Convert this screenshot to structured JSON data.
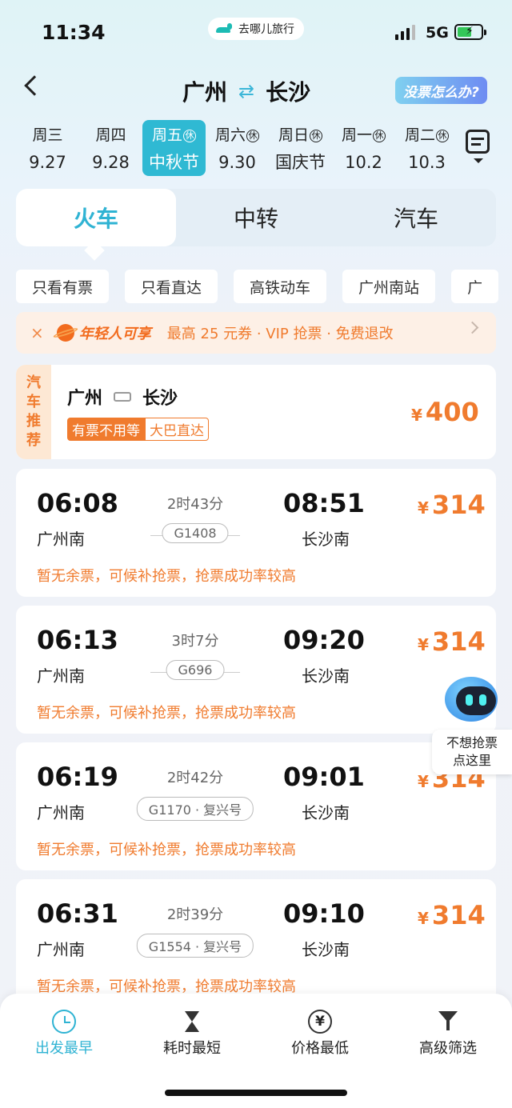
{
  "status_bar": {
    "time": "11:34",
    "app_badge": "去哪儿旅行",
    "network": "5G"
  },
  "header": {
    "from": "广州",
    "to": "长沙",
    "help_button": "没票怎么办?"
  },
  "dates": [
    {
      "weekday": "周三",
      "date": "9.27",
      "rest": false,
      "active": false
    },
    {
      "weekday": "周四",
      "date": "9.28",
      "rest": false,
      "active": false
    },
    {
      "weekday": "周五",
      "date": "中秋节",
      "rest": true,
      "active": true
    },
    {
      "weekday": "周六",
      "date": "9.30",
      "rest": true,
      "active": false
    },
    {
      "weekday": "周日",
      "date": "国庆节",
      "rest": true,
      "active": false
    },
    {
      "weekday": "周一",
      "date": "10.2",
      "rest": true,
      "active": false
    },
    {
      "weekday": "周二",
      "date": "10.3",
      "rest": true,
      "active": false
    }
  ],
  "rest_mark": "休",
  "mode_tabs": {
    "train": "火车",
    "transfer": "中转",
    "bus": "汽车"
  },
  "filters": [
    "只看有票",
    "只看直达",
    "高铁动车",
    "广州南站",
    "广"
  ],
  "promo": {
    "close": "×",
    "tag": "年轻人可享",
    "text": "最高 25 元券 · VIP 抢票 · 免费退改"
  },
  "bus_card": {
    "side_label": "汽车推荐",
    "from": "广州",
    "to": "长沙",
    "tag1": "有票不用等",
    "tag2": "大巴直达",
    "currency": "¥",
    "price": "400"
  },
  "trains": [
    {
      "dep": "06:08",
      "arr": "08:51",
      "duration": "2时43分",
      "from": "广州南",
      "to": "长沙南",
      "number": "G1408",
      "price": "314",
      "note": "暂无余票，可候补抢票，抢票成功率较高"
    },
    {
      "dep": "06:13",
      "arr": "09:20",
      "duration": "3时7分",
      "from": "广州南",
      "to": "长沙南",
      "number": "G696",
      "price": "314",
      "note": "暂无余票，可候补抢票，抢票成功率较高"
    },
    {
      "dep": "06:19",
      "arr": "09:01",
      "duration": "2时42分",
      "from": "广州南",
      "to": "长沙南",
      "number": "G1170 · 复兴号",
      "price": "314",
      "note": "暂无余票，可候补抢票，抢票成功率较高"
    },
    {
      "dep": "06:31",
      "arr": "09:10",
      "duration": "2时39分",
      "from": "广州南",
      "to": "长沙南",
      "number": "G1554 · 复兴号",
      "price": "314",
      "note": "暂无余票，可候补抢票，抢票成功率较高"
    }
  ],
  "currency": "¥",
  "robot": {
    "line1": "不想抢票",
    "line2": "点这里"
  },
  "bottom_bar": {
    "earliest": "出发最早",
    "shortest": "耗时最短",
    "cheapest": "价格最低",
    "advanced": "高级筛选"
  },
  "colors": {
    "accent": "#2fb3d3",
    "orange": "#f07b2e"
  }
}
